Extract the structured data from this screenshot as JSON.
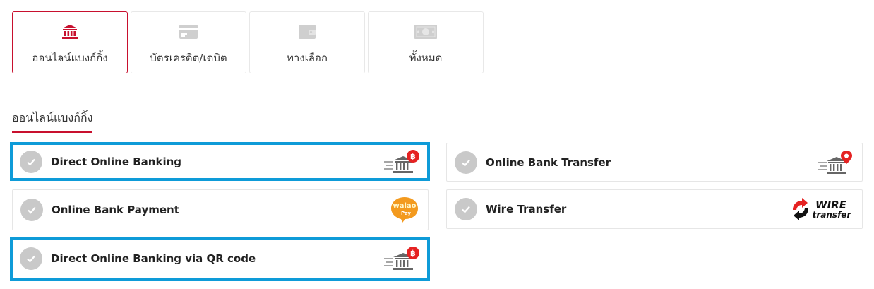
{
  "tabs": [
    {
      "label": "ออนไลน์แบงก์กิ้ง",
      "icon": "bank-icon",
      "active": true
    },
    {
      "label": "บัตรเครดิต/เดบิต",
      "icon": "credit-card-icon",
      "active": false
    },
    {
      "label": "ทางเลือก",
      "icon": "wallet-icon",
      "active": false
    },
    {
      "label": "ทั้งหมด",
      "icon": "cash-icon",
      "active": false
    }
  ],
  "section": {
    "title": "ออนไลน์แบงก์กิ้ง"
  },
  "methods": [
    {
      "label": "Direct Online Banking",
      "logo": "bank-baht-icon",
      "highlighted": true
    },
    {
      "label": "Online Bank Transfer",
      "logo": "bank-pin-icon",
      "highlighted": false
    },
    {
      "label": "Online Bank Payment",
      "logo": "walao-pay-logo",
      "highlighted": false
    },
    {
      "label": "Wire Transfer",
      "logo": "wire-transfer-logo",
      "highlighted": false
    },
    {
      "label": "Direct Online Banking via QR code",
      "logo": "bank-baht-icon",
      "highlighted": true
    }
  ],
  "logos": {
    "walao_top": "walao",
    "walao_bottom": "Pay",
    "wire_top": "WIRE",
    "wire_bottom": "transfer",
    "baht_symbol": "฿"
  },
  "colors": {
    "accent": "#c8102e",
    "highlight": "#0e9bd8",
    "inactive_icon": "#cfcfcf",
    "check_bg": "#c9c9c9",
    "walao_orange": "#f39a1e"
  }
}
